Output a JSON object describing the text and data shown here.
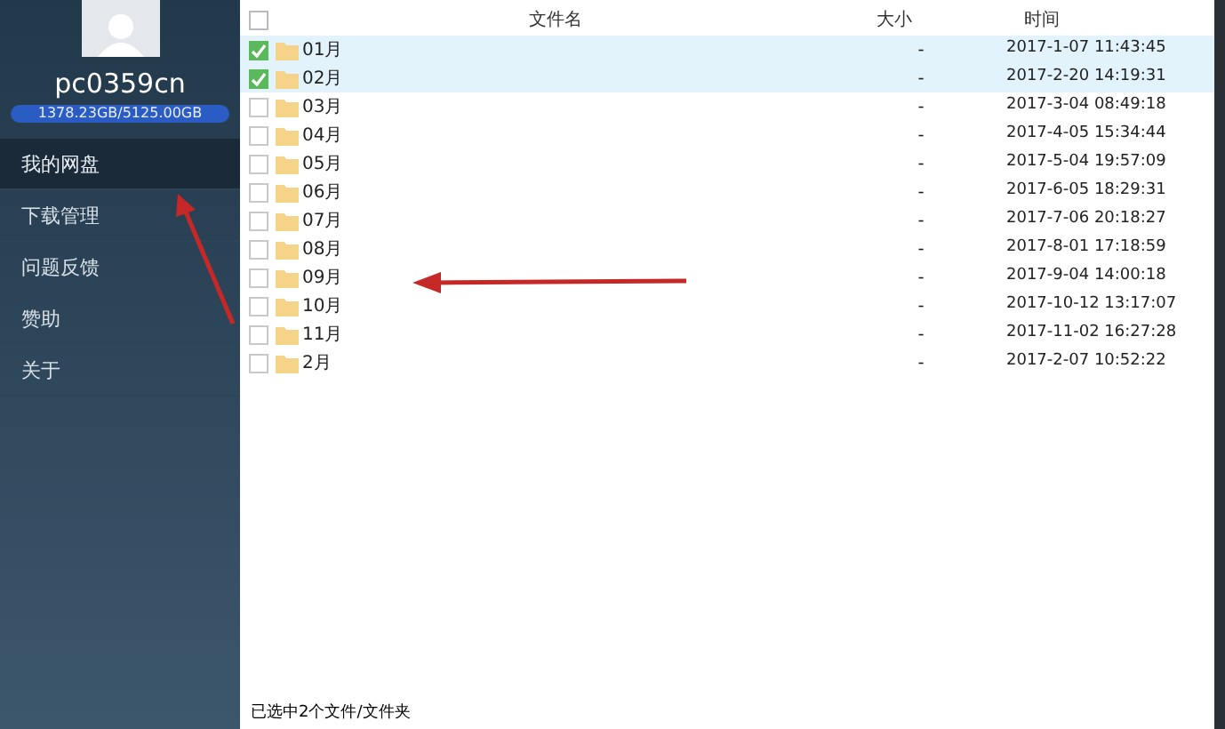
{
  "sidebar": {
    "username": "pc0359cn",
    "storage": "1378.23GB/5125.00GB",
    "items": [
      {
        "label": "我的网盘",
        "selected": true
      },
      {
        "label": "下载管理",
        "selected": false
      },
      {
        "label": "问题反馈",
        "selected": false
      },
      {
        "label": "赞助",
        "selected": false
      },
      {
        "label": "关于",
        "selected": false
      }
    ]
  },
  "table": {
    "select_all": false,
    "columns": [
      "文件名",
      "大小",
      "时间"
    ],
    "rows": [
      {
        "name": "01月",
        "size": "-",
        "time": "2017-1-07 11:43:45",
        "checked": true
      },
      {
        "name": "02月",
        "size": "-",
        "time": "2017-2-20 14:19:31",
        "checked": true
      },
      {
        "name": "03月",
        "size": "-",
        "time": "2017-3-04 08:49:18",
        "checked": false
      },
      {
        "name": "04月",
        "size": "-",
        "time": "2017-4-05 15:34:44",
        "checked": false
      },
      {
        "name": "05月",
        "size": "-",
        "time": "2017-5-04 19:57:09",
        "checked": false
      },
      {
        "name": "06月",
        "size": "-",
        "time": "2017-6-05 18:29:31",
        "checked": false
      },
      {
        "name": "07月",
        "size": "-",
        "time": "2017-7-06 20:18:27",
        "checked": false
      },
      {
        "name": "08月",
        "size": "-",
        "time": "2017-8-01 17:18:59",
        "checked": false
      },
      {
        "name": "09月",
        "size": "-",
        "time": "2017-9-04 14:00:18",
        "checked": false
      },
      {
        "name": "10月",
        "size": "-",
        "time": "2017-10-12 13:17:07",
        "checked": false
      },
      {
        "name": "11月",
        "size": "-",
        "time": "2017-11-02 16:27:28",
        "checked": false
      },
      {
        "name": "2月",
        "size": "-",
        "time": "2017-2-07 10:52:22",
        "checked": false
      }
    ]
  },
  "status_bar": "已选中2个文件/文件夹"
}
